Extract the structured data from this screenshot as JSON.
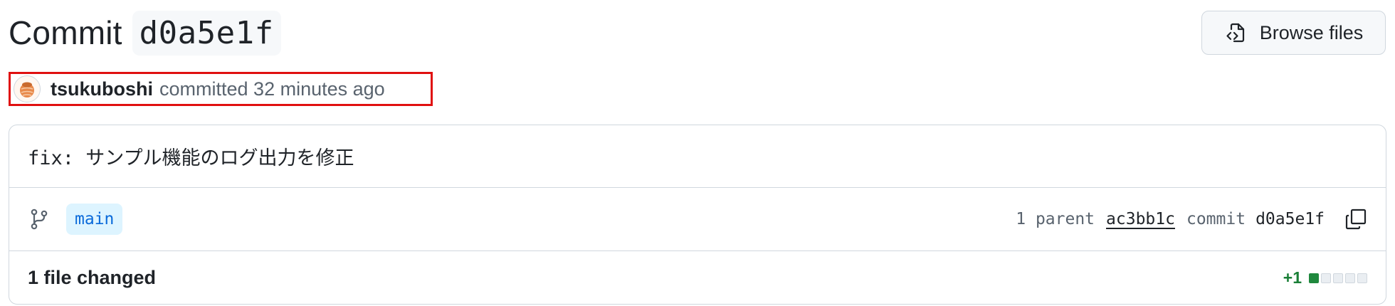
{
  "header": {
    "title_word": "Commit",
    "sha": "d0a5e1f",
    "browse_label": "Browse files",
    "browse_icon": "file-code-icon"
  },
  "author": {
    "avatar_icon": "avatar-icon",
    "name": "tsukuboshi",
    "meta": "committed 32 minutes ago"
  },
  "commit": {
    "message": "fix: サンプル機能のログ出力を修正",
    "branch_icon": "git-branch-icon",
    "branch": "main",
    "parent_count_label": "1 parent",
    "parent_sha": "ac3bb1c",
    "commit_label": "commit",
    "commit_sha": "d0a5e1f",
    "copy_icon": "copy-icon"
  },
  "files": {
    "changed_label": "1 file changed",
    "additions": "+1",
    "diffstat_blocks": [
      "added",
      "neutral",
      "neutral",
      "neutral",
      "neutral"
    ]
  },
  "colors": {
    "accent_blue": "#0969da",
    "branch_chip_bg": "#ddf4ff",
    "added_green": "#1f883d",
    "added_text": "#1a7f37",
    "border": "#d0d7de",
    "highlight_red": "#e01010"
  }
}
